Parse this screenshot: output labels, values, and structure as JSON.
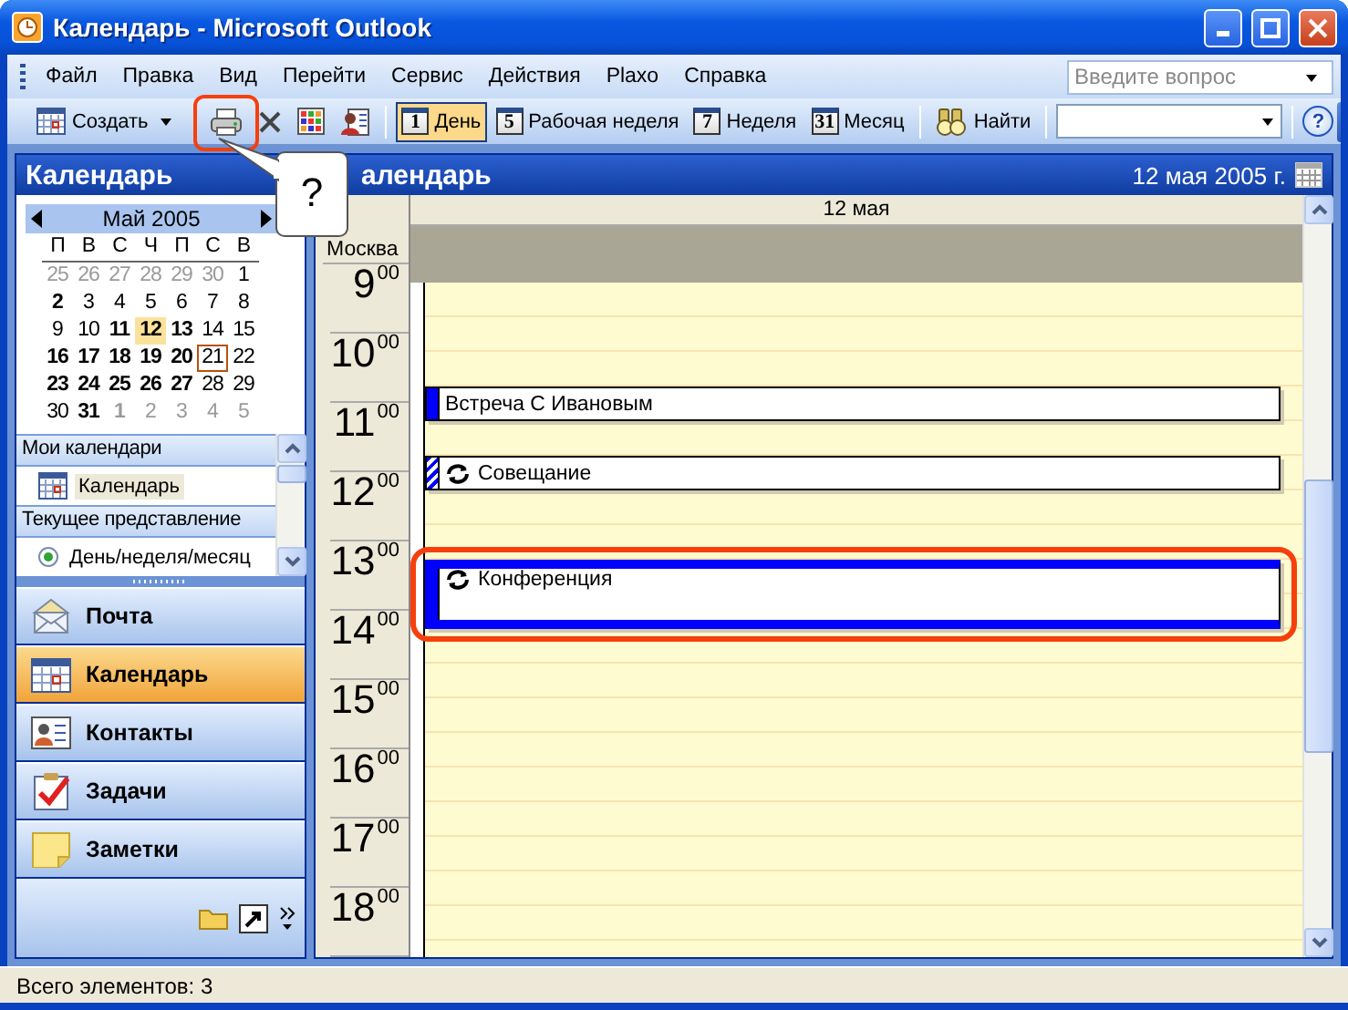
{
  "window": {
    "title": "Календарь - Microsoft Outlook"
  },
  "menu": [
    "Файл",
    "Правка",
    "Вид",
    "Перейти",
    "Сервис",
    "Действия",
    "Plaxo",
    "Справка"
  ],
  "help_search": {
    "placeholder": "Введите вопрос"
  },
  "toolbar": [
    {
      "kind": "new",
      "label": "Создать",
      "selected": false
    },
    {
      "kind": "print",
      "selected": false,
      "highlighted": true
    },
    {
      "kind": "delete",
      "selected": false
    },
    {
      "kind": "grid",
      "selected": false
    },
    {
      "kind": "address_book",
      "selected": false
    },
    {
      "kind": "view",
      "label": "День",
      "icon_text": "1",
      "selected": true
    },
    {
      "kind": "view",
      "label": "Рабочая неделя",
      "icon_text": "5",
      "selected": false
    },
    {
      "kind": "view",
      "label": "Неделя",
      "icon_text": "7",
      "selected": false
    },
    {
      "kind": "view",
      "label": "Месяц",
      "icon_text": "31",
      "selected": false
    },
    {
      "kind": "find",
      "label": "Найти",
      "selected": false
    },
    {
      "kind": "combo",
      "selected": false
    },
    {
      "kind": "help",
      "icon_text": "?",
      "selected": false
    }
  ],
  "callout": {
    "text": "?"
  },
  "nav_pane": {
    "title": "Календарь",
    "mini_calendar": {
      "month": "Май 2005",
      "weekdays": [
        "П",
        "В",
        "С",
        "Ч",
        "П",
        "С",
        "В"
      ],
      "weeks": [
        [
          {
            "d": "25",
            "bold": false,
            "muted": true,
            "selected": false,
            "today": false
          },
          {
            "d": "26",
            "bold": false,
            "muted": true,
            "selected": false,
            "today": false
          },
          {
            "d": "27",
            "bold": false,
            "muted": true,
            "selected": false,
            "today": false
          },
          {
            "d": "28",
            "bold": false,
            "muted": true,
            "selected": false,
            "today": false
          },
          {
            "d": "29",
            "bold": false,
            "muted": true,
            "selected": false,
            "today": false
          },
          {
            "d": "30",
            "bold": false,
            "muted": true,
            "selected": false,
            "today": false
          },
          {
            "d": "1",
            "bold": false,
            "muted": false,
            "selected": false,
            "today": false
          }
        ],
        [
          {
            "d": "2",
            "bold": true,
            "muted": false,
            "selected": false,
            "today": false
          },
          {
            "d": "3",
            "bold": false,
            "muted": false,
            "selected": false,
            "today": false
          },
          {
            "d": "4",
            "bold": false,
            "muted": false,
            "selected": false,
            "today": false
          },
          {
            "d": "5",
            "bold": false,
            "muted": false,
            "selected": false,
            "today": false
          },
          {
            "d": "6",
            "bold": false,
            "muted": false,
            "selected": false,
            "today": false
          },
          {
            "d": "7",
            "bold": false,
            "muted": false,
            "selected": false,
            "today": false
          },
          {
            "d": "8",
            "bold": false,
            "muted": false,
            "selected": false,
            "today": false
          }
        ],
        [
          {
            "d": "9",
            "bold": false,
            "muted": false,
            "selected": false,
            "today": false
          },
          {
            "d": "10",
            "bold": false,
            "muted": false,
            "selected": false,
            "today": false
          },
          {
            "d": "11",
            "bold": true,
            "muted": false,
            "selected": false,
            "today": false
          },
          {
            "d": "12",
            "bold": true,
            "muted": false,
            "selected": true,
            "today": false
          },
          {
            "d": "13",
            "bold": true,
            "muted": false,
            "selected": false,
            "today": false
          },
          {
            "d": "14",
            "bold": false,
            "muted": false,
            "selected": false,
            "today": false
          },
          {
            "d": "15",
            "bold": false,
            "muted": false,
            "selected": false,
            "today": false
          }
        ],
        [
          {
            "d": "16",
            "bold": true,
            "muted": false,
            "selected": false,
            "today": false
          },
          {
            "d": "17",
            "bold": true,
            "muted": false,
            "selected": false,
            "today": false
          },
          {
            "d": "18",
            "bold": true,
            "muted": false,
            "selected": false,
            "today": false
          },
          {
            "d": "19",
            "bold": true,
            "muted": false,
            "selected": false,
            "today": false
          },
          {
            "d": "20",
            "bold": true,
            "muted": false,
            "selected": false,
            "today": false
          },
          {
            "d": "21",
            "bold": false,
            "muted": false,
            "selected": false,
            "today": true
          },
          {
            "d": "22",
            "bold": false,
            "muted": false,
            "selected": false,
            "today": false
          }
        ],
        [
          {
            "d": "23",
            "bold": true,
            "muted": false,
            "selected": false,
            "today": false
          },
          {
            "d": "24",
            "bold": true,
            "muted": false,
            "selected": false,
            "today": false
          },
          {
            "d": "25",
            "bold": true,
            "muted": false,
            "selected": false,
            "today": false
          },
          {
            "d": "26",
            "bold": true,
            "muted": false,
            "selected": false,
            "today": false
          },
          {
            "d": "27",
            "bold": true,
            "muted": false,
            "selected": false,
            "today": false
          },
          {
            "d": "28",
            "bold": false,
            "muted": false,
            "selected": false,
            "today": false
          },
          {
            "d": "29",
            "bold": false,
            "muted": false,
            "selected": false,
            "today": false
          }
        ],
        [
          {
            "d": "30",
            "bold": false,
            "muted": false,
            "selected": false,
            "today": false
          },
          {
            "d": "31",
            "bold": true,
            "muted": false,
            "selected": false,
            "today": false
          },
          {
            "d": "1",
            "bold": true,
            "muted": true,
            "selected": false,
            "today": false
          },
          {
            "d": "2",
            "bold": false,
            "muted": true,
            "selected": false,
            "today": false
          },
          {
            "d": "3",
            "bold": false,
            "muted": true,
            "selected": false,
            "today": false
          },
          {
            "d": "4",
            "bold": false,
            "muted": true,
            "selected": false,
            "today": false
          },
          {
            "d": "5",
            "bold": false,
            "muted": true,
            "selected": false,
            "today": false
          }
        ]
      ]
    },
    "sections": [
      {
        "title": "Мои календари",
        "items": [
          {
            "label": "Календарь",
            "kind": "calendar",
            "selected": true
          }
        ]
      },
      {
        "title": "Текущее представление",
        "items": [
          {
            "label": "День/неделя/месяц",
            "kind": "radio",
            "selected": true
          }
        ]
      }
    ]
  },
  "nav_buttons": [
    {
      "label": "Почта",
      "kind": "mail",
      "selected": false
    },
    {
      "label": "Календарь",
      "kind": "calendar",
      "selected": true
    },
    {
      "label": "Контакты",
      "kind": "contacts",
      "selected": false
    },
    {
      "label": "Задачи",
      "kind": "tasks",
      "selected": false
    },
    {
      "label": "Заметки",
      "kind": "notes",
      "selected": false
    }
  ],
  "calendar": {
    "title": "алендарь",
    "date": "12 мая 2005 г.",
    "day": "12 мая",
    "timezone": "Москва",
    "hours": [
      {
        "hour": "9",
        "minutes": "00"
      },
      {
        "hour": "10",
        "minutes": "00",
        "second_half": [
          {
            "subject": "Встреча С Ивановым",
            "one_hour": false,
            "tentative": false,
            "recurring": false,
            "selected": false
          }
        ]
      },
      {
        "hour": "11",
        "minutes": "00",
        "second_half": [
          {
            "subject": "Совещание",
            "one_hour": false,
            "tentative": true,
            "recurring": true,
            "selected": false
          }
        ]
      },
      {
        "hour": "12",
        "minutes": "00"
      },
      {
        "hour": "13",
        "minutes": "00",
        "first_half": [
          {
            "subject": "Конференция",
            "one_hour": true,
            "tentative": false,
            "recurring": true,
            "selected": true,
            "highlighted": true
          }
        ]
      },
      {
        "hour": "14",
        "minutes": "00"
      },
      {
        "hour": "15",
        "minutes": "00"
      },
      {
        "hour": "16",
        "minutes": "00"
      },
      {
        "hour": "17",
        "minutes": "00"
      },
      {
        "hour": "18",
        "minutes": "00"
      }
    ]
  },
  "status_bar": {
    "text": "Всего элементов: 3"
  }
}
